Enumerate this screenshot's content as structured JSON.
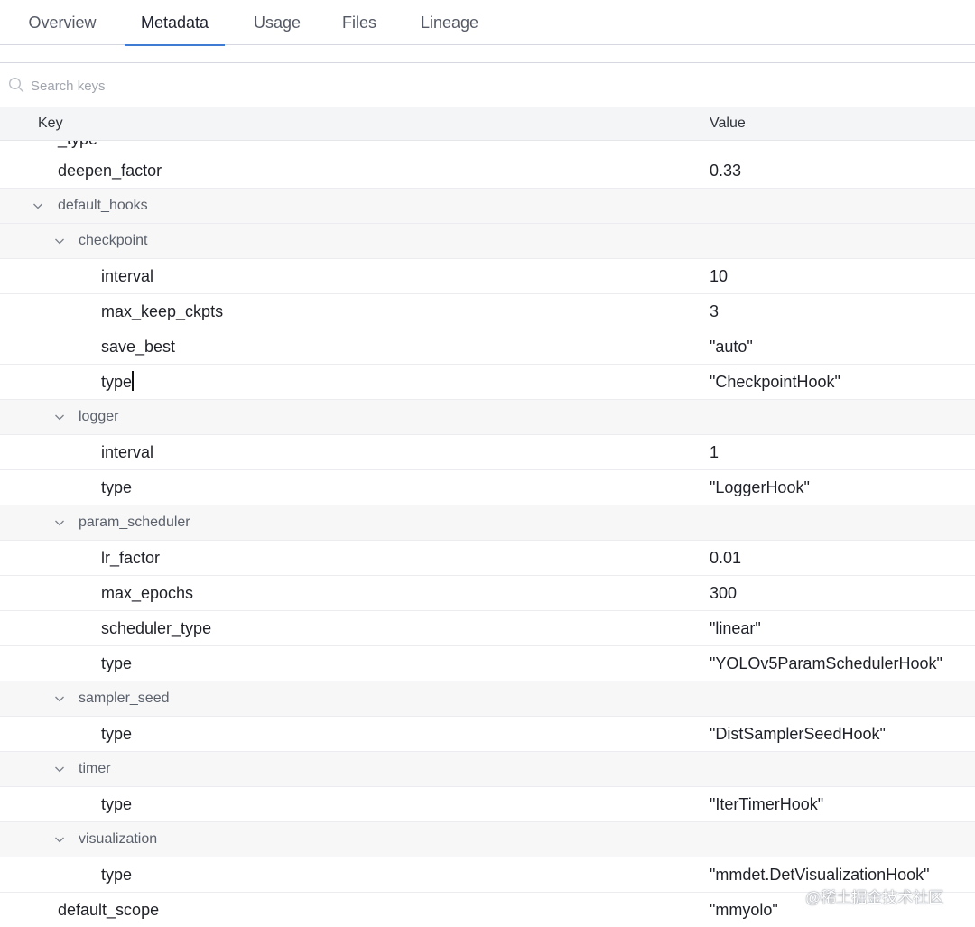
{
  "tabs": [
    {
      "label": "Overview",
      "active": false
    },
    {
      "label": "Metadata",
      "active": true
    },
    {
      "label": "Usage",
      "active": false
    },
    {
      "label": "Files",
      "active": false
    },
    {
      "label": "Lineage",
      "active": false
    }
  ],
  "search": {
    "placeholder": "Search keys",
    "value": ""
  },
  "table": {
    "headers": {
      "key": "Key",
      "value": "Value"
    },
    "rows": [
      {
        "key": "_type",
        "value": "",
        "level": 1,
        "group": false,
        "partial": true
      },
      {
        "key": "deepen_factor",
        "value": "0.33",
        "level": 1,
        "group": false
      },
      {
        "key": "default_hooks",
        "value": "",
        "level": 1,
        "group": true,
        "expanded": true
      },
      {
        "key": "checkpoint",
        "value": "",
        "level": 2,
        "group": true,
        "expanded": true
      },
      {
        "key": "interval",
        "value": "10",
        "level": 3,
        "group": false
      },
      {
        "key": "max_keep_ckpts",
        "value": "3",
        "level": 3,
        "group": false
      },
      {
        "key": "save_best",
        "value": "\"auto\"",
        "level": 3,
        "group": false
      },
      {
        "key": "type",
        "value": "\"CheckpointHook\"",
        "level": 3,
        "group": false
      },
      {
        "key": "logger",
        "value": "",
        "level": 2,
        "group": true,
        "expanded": true
      },
      {
        "key": "interval",
        "value": "1",
        "level": 3,
        "group": false
      },
      {
        "key": "type",
        "value": "\"LoggerHook\"",
        "level": 3,
        "group": false
      },
      {
        "key": "param_scheduler",
        "value": "",
        "level": 2,
        "group": true,
        "expanded": true
      },
      {
        "key": "lr_factor",
        "value": "0.01",
        "level": 3,
        "group": false
      },
      {
        "key": "max_epochs",
        "value": "300",
        "level": 3,
        "group": false
      },
      {
        "key": "scheduler_type",
        "value": "\"linear\"",
        "level": 3,
        "group": false
      },
      {
        "key": "type",
        "value": "\"YOLOv5ParamSchedulerHook\"",
        "level": 3,
        "group": false
      },
      {
        "key": "sampler_seed",
        "value": "",
        "level": 2,
        "group": true,
        "expanded": true
      },
      {
        "key": "type",
        "value": "\"DistSamplerSeedHook\"",
        "level": 3,
        "group": false
      },
      {
        "key": "timer",
        "value": "",
        "level": 2,
        "group": true,
        "expanded": true
      },
      {
        "key": "type",
        "value": "\"IterTimerHook\"",
        "level": 3,
        "group": false
      },
      {
        "key": "visualization",
        "value": "",
        "level": 2,
        "group": true,
        "expanded": true
      },
      {
        "key": "type",
        "value": "\"mmdet.DetVisualizationHook\"",
        "level": 3,
        "group": false
      },
      {
        "key": "default_scope",
        "value": "\"mmyolo\"",
        "level": 1,
        "group": false
      }
    ]
  },
  "watermark": "@稀土掘金技术社区",
  "colors": {
    "accent": "#3f7ad3",
    "header_bg": "#f4f5f6",
    "group_bg": "#f7f7f8",
    "border": "#eaecef"
  },
  "icons": {
    "search": "search-icon",
    "expand": "chevron-down-icon"
  }
}
